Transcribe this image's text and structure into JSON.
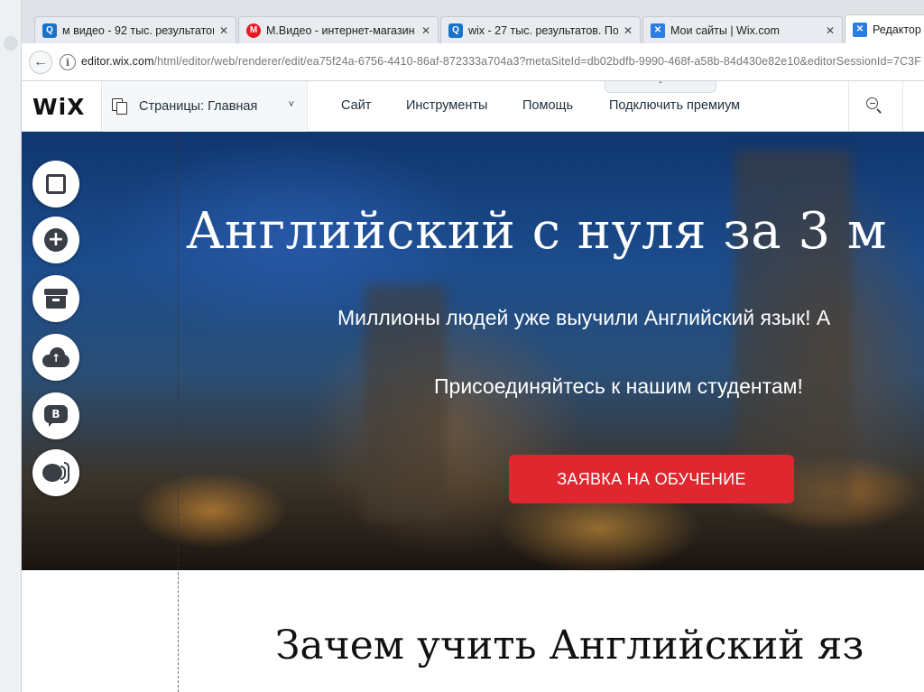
{
  "browser": {
    "tabs": [
      {
        "title": "м видео - 92 тыс. результатов",
        "favicon": "search-icon",
        "active": false
      },
      {
        "title": "М.Видео - интернет-магазин",
        "favicon": "mvideo-logo",
        "active": false
      },
      {
        "title": "wix - 27 тыс. результатов. По",
        "favicon": "search-icon",
        "active": false
      },
      {
        "title": "Мои сайты | Wix.com",
        "favicon": "wix-icon",
        "active": false
      },
      {
        "title": "Редактор",
        "favicon": "wix-icon",
        "active": true
      }
    ],
    "close_glyph": "✕",
    "url_host": "editor.wix.com",
    "url_path": "/html/editor/web/renderer/edit/ea75f24a-6756-4410-86af-872333a704a3?metaSiteId=db02bdfb-9990-468f-a58b-84d430e82e10&editorSessionId=7C3F"
  },
  "editor": {
    "logo": "WiX",
    "pages_label": "Страницы: Главная",
    "menu": [
      "Сайт",
      "Инструменты",
      "Помощь",
      "Подключить премиум"
    ],
    "collapse_glyph": "ˆ"
  },
  "left_tools": [
    {
      "icon": "background-icon"
    },
    {
      "icon": "add-icon"
    },
    {
      "icon": "app-market-icon"
    },
    {
      "icon": "upload-icon"
    },
    {
      "icon": "blog-icon",
      "glyph": "B"
    },
    {
      "icon": "chat-icon"
    }
  ],
  "hero": {
    "title": "Английский с нуля за 3 м",
    "subtitle": "Миллионы людей уже выучили Английский язык! А",
    "join": "Присоединяйтесь к нашим студентам!",
    "cta": "ЗАЯВКА НА ОБУЧЕНИЕ"
  },
  "section": {
    "title": "Зачем учить Английский яз"
  },
  "colors": {
    "cta": "#e0262f",
    "hero_sky": "#10366e",
    "icon_dark": "#3a3f46"
  }
}
